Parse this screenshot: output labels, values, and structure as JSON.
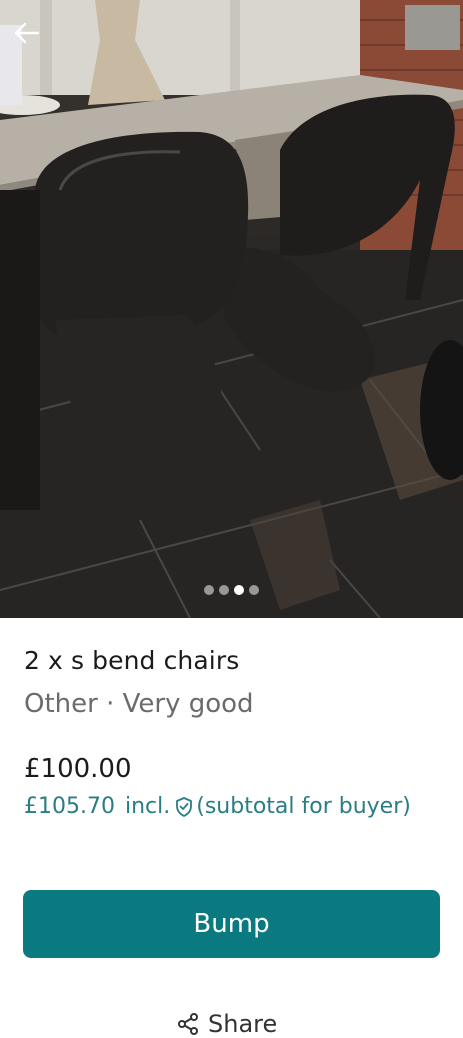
{
  "listing": {
    "title": "2 x s bend chairs",
    "subtitle": "Other · Very good",
    "price": "£100.00",
    "buyer_price": "£105.70",
    "buyer_incl": "incl.",
    "buyer_note": "(subtotal for buyer)"
  },
  "gallery": {
    "slide_count": 4,
    "active_index": 2
  },
  "actions": {
    "bump_label": "Bump",
    "share_label": "Share"
  },
  "colors": {
    "accent": "#0b7a80",
    "accent_text": "#2a7d83"
  },
  "icons": {
    "back": "arrow-left-icon",
    "shield": "shield-check-icon",
    "share": "share-icon"
  }
}
